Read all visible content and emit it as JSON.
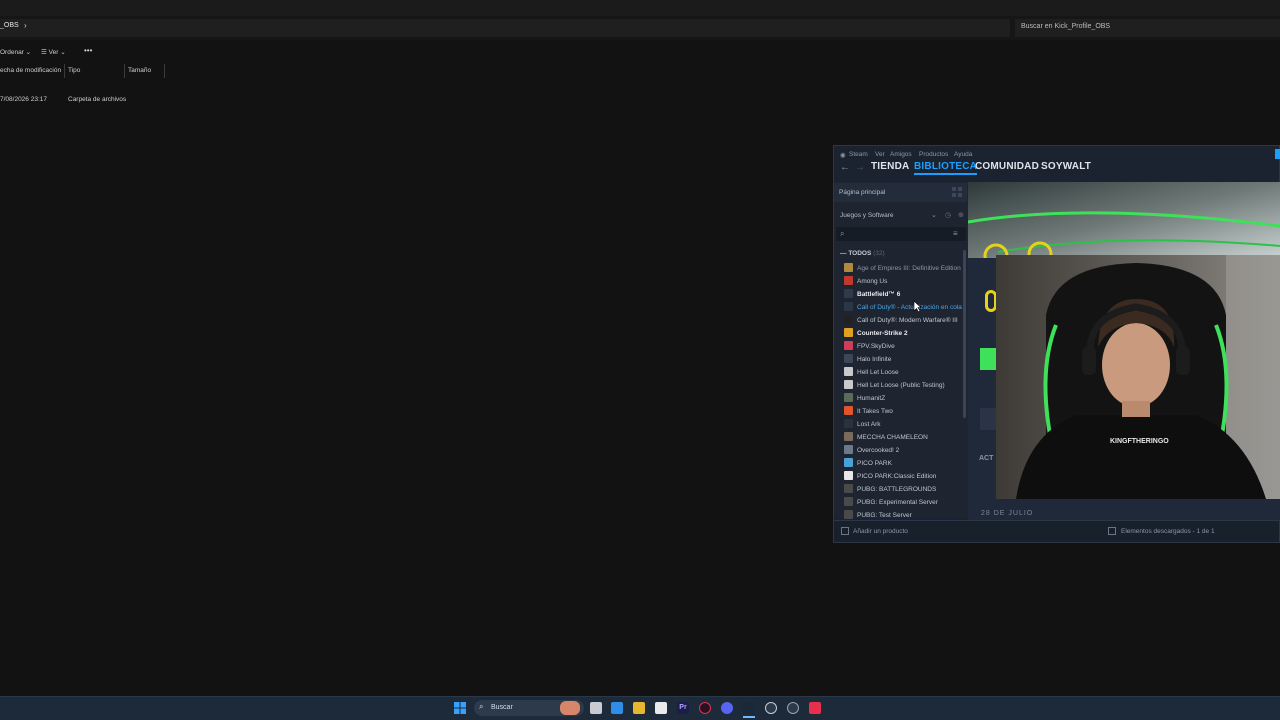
{
  "explorer": {
    "address_fragment": "_OBS",
    "search_placeholder": "Buscar en Kick_Profile_OBS",
    "toolbar": {
      "sort_label": "Ordenar",
      "view_label": "Ver",
      "more_label": "•••"
    },
    "columns": [
      "echa de modificación",
      "Tipo",
      "Tamaño"
    ],
    "rows": [
      {
        "date": "7/08/2026 23:17",
        "type": "Carpeta de archivos"
      }
    ]
  },
  "steam": {
    "menu": [
      "Steam",
      "Ver",
      "Amigos",
      "Productos",
      "Ayuda"
    ],
    "nav": {
      "store": "TIENDA",
      "library": "BIBLIOTECA",
      "community": "COMUNIDAD",
      "user": "SOYWALT"
    },
    "home_label": "Página principal",
    "filter_label": "Juegos y Software",
    "section_label": "TODOS",
    "section_count": "(32)",
    "games": [
      {
        "name": "Age of Empires III: Definitive Edition",
        "color": "#b08a40",
        "style": "dim"
      },
      {
        "name": "Among Us",
        "color": "#c0392b",
        "style": ""
      },
      {
        "name": "Battlefield™ 6",
        "color": "#2f3b4a",
        "style": "bold"
      },
      {
        "name": "Call of Duty® - Actualización en cola",
        "color": "#2c3644",
        "style": "hl"
      },
      {
        "name": "Call of Duty®: Modern Warfare® III",
        "color": "#222222",
        "style": ""
      },
      {
        "name": "Counter-Strike 2",
        "color": "#e0a020",
        "style": "bold"
      },
      {
        "name": "FPV.SkyDive",
        "color": "#d23c5a",
        "style": ""
      },
      {
        "name": "Halo Infinite",
        "color": "#3b4756",
        "style": ""
      },
      {
        "name": "Hell Let Loose",
        "color": "#c9c9c9",
        "style": ""
      },
      {
        "name": "Hell Let Loose (Public Testing)",
        "color": "#c9c9c9",
        "style": ""
      },
      {
        "name": "HumanitZ",
        "color": "#5a6b5a",
        "style": ""
      },
      {
        "name": "It Takes Two",
        "color": "#e0552a",
        "style": ""
      },
      {
        "name": "Lost Ark",
        "color": "#2a3240",
        "style": ""
      },
      {
        "name": "MECCHA CHAMELEON",
        "color": "#7a6a5a",
        "style": ""
      },
      {
        "name": "Overcooked! 2",
        "color": "#6b7a8a",
        "style": ""
      },
      {
        "name": "PICO PARK",
        "color": "#4aa0d8",
        "style": ""
      },
      {
        "name": "PICO PARK:Classic Edition",
        "color": "#e8e8e8",
        "style": ""
      },
      {
        "name": "PUBG: BATTLEGROUNDS",
        "color": "#4a4a4a",
        "style": ""
      },
      {
        "name": "PUBG: Experimental Server",
        "color": "#4a4a4a",
        "style": ""
      },
      {
        "name": "PUBG: Test Server",
        "color": "#4a4a4a",
        "style": ""
      }
    ],
    "add_product": "Añadir un producto",
    "downloads": "Elementos descargados - 1 de 1",
    "activity_label": "ACT",
    "date_label": "28 DE JULIO"
  },
  "webcam": {
    "shirt_text": "KINGFTHERINGO"
  },
  "taskbar": {
    "search_label": "Buscar"
  },
  "colors": {
    "steam_blue": "#1a9fff",
    "steam_bg": "#1b2331",
    "green_accent": "#22c23c"
  }
}
